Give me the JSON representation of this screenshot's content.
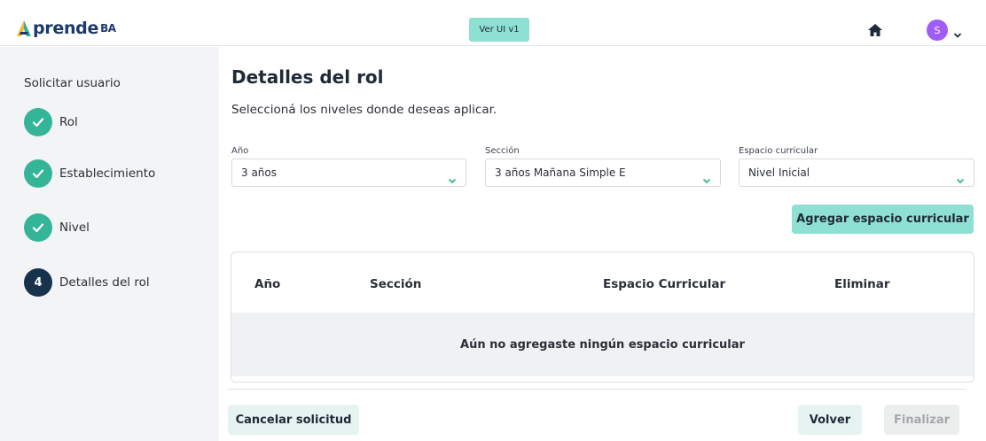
{
  "header": {
    "logo_text": "prende",
    "logo_suffix": "BA",
    "version_button": "Ver UI v1",
    "avatar_initial": "S",
    "icons": {
      "home": "home-icon",
      "menu_caret": "chevron-down-icon"
    }
  },
  "sidebar": {
    "title": "Solicitar usuario",
    "steps": [
      {
        "label": "Rol",
        "state": "done"
      },
      {
        "label": "Establecimiento",
        "state": "done"
      },
      {
        "label": "Nivel",
        "state": "done"
      },
      {
        "label": "Detalles del rol",
        "number": "4",
        "state": "current"
      }
    ]
  },
  "main": {
    "title": "Detalles del rol",
    "subtitle": "Seleccioná los niveles donde deseas aplicar.",
    "fields": {
      "anio": {
        "label": "Año",
        "value": "3 años"
      },
      "seccion": {
        "label": "Sección",
        "value": "3 años Mañana Simple E"
      },
      "espacio": {
        "label": "Espacio curricular",
        "value": "Nivel Inicial"
      }
    },
    "add_button": "Agregar espacio curricular",
    "table": {
      "columns": [
        "Año",
        "Sección",
        "Espacio Curricular",
        "Eliminar"
      ],
      "empty_message": "Aún no agregaste ningún espacio curricular"
    }
  },
  "footer": {
    "cancel_button": "Cancelar solicitud",
    "back_button": "Volver",
    "finish_button": "Finalizar"
  },
  "colors": {
    "accent": "#8ee0d2",
    "step_done": "#35b597",
    "step_current": "#17324d",
    "avatar": "#a05cf5",
    "brand_text": "#1b3a6b"
  }
}
